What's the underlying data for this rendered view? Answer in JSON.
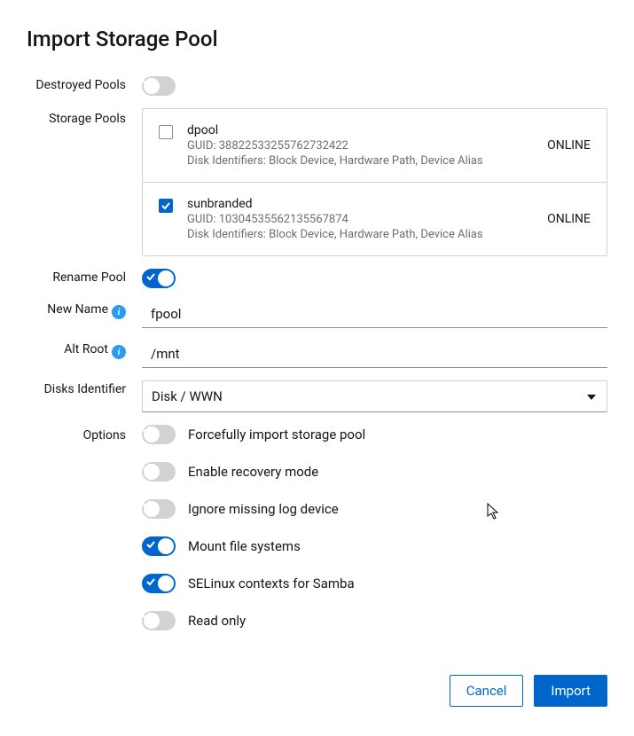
{
  "title": "Import Storage Pool",
  "labels": {
    "destroyed_pools": "Destroyed Pools",
    "storage_pools": "Storage Pools",
    "rename_pool": "Rename Pool",
    "new_name": "New Name",
    "alt_root": "Alt Root",
    "disks_identifier": "Disks Identifier",
    "options": "Options"
  },
  "pools": [
    {
      "name": "dpool",
      "guid": "GUID: 38822533255762732422",
      "disk": "Disk Identifiers: Block Device, Hardware Path, Device Alias",
      "status": "ONLINE",
      "checked": false
    },
    {
      "name": "sunbranded",
      "guid": "GUID: 10304535562135567874",
      "disk": "Disk Identifiers: Block Device, Hardware Path, Device Alias",
      "status": "ONLINE",
      "checked": true
    }
  ],
  "form": {
    "destroyed_pools_on": false,
    "rename_pool_on": true,
    "new_name": "fpool",
    "alt_root": "/mnt",
    "disks_identifier_selected": "Disk / WWN"
  },
  "options": [
    {
      "label": "Forcefully import storage pool",
      "on": false
    },
    {
      "label": "Enable recovery mode",
      "on": false
    },
    {
      "label": "Ignore missing log device",
      "on": false
    },
    {
      "label": "Mount file systems",
      "on": true
    },
    {
      "label": "SELinux contexts for Samba",
      "on": true
    },
    {
      "label": "Read only",
      "on": false
    }
  ],
  "footer": {
    "cancel": "Cancel",
    "import": "Import"
  },
  "colors": {
    "primary": "#0066cc",
    "muted": "#6a6e73",
    "border": "#d2d2d2"
  }
}
